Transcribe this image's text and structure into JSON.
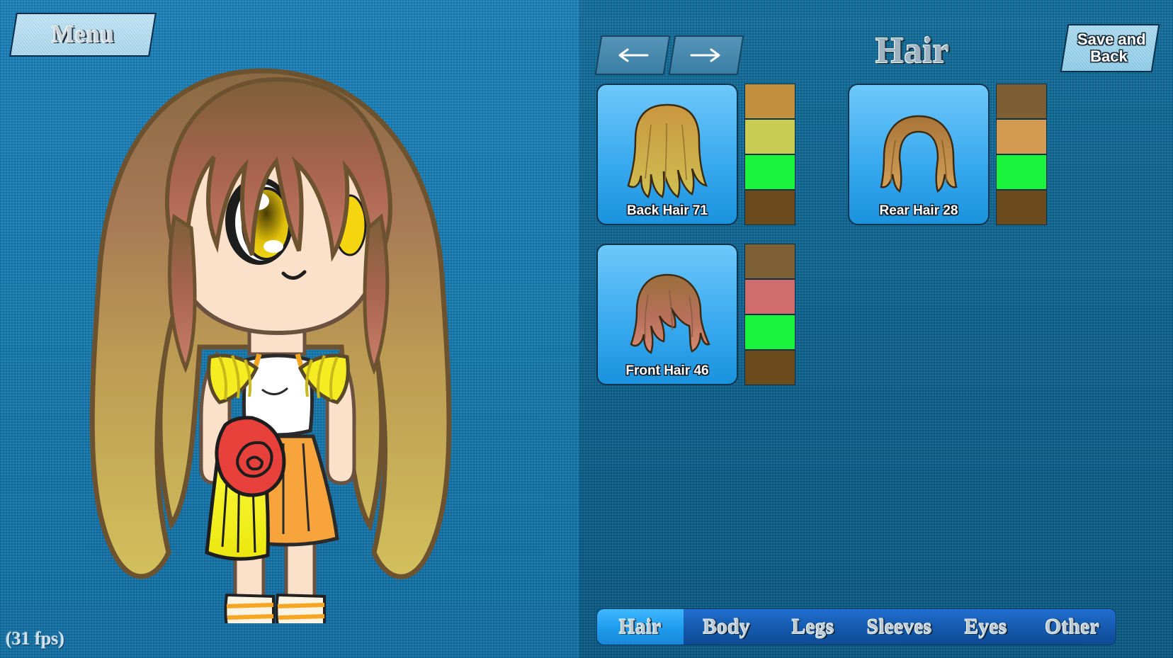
{
  "app": {
    "menu_label": "Menu",
    "fps_label": "(31 fps)"
  },
  "editor": {
    "category_title": "Hair",
    "prev_label": "←",
    "next_label": "→",
    "save_back_line1": "Save and",
    "save_back_line2": "Back"
  },
  "items": [
    {
      "label": "Back Hair 71",
      "thumb": "back-hair-thumb",
      "swatches": [
        "#c0903f",
        "#c9cc53",
        "#1bf43c",
        "#6b4a1e"
      ]
    },
    {
      "label": "Rear Hair 28",
      "thumb": "rear-hair-thumb",
      "swatches": [
        "#7d5f33",
        "#d39b52",
        "#1bf43c",
        "#6b4a1e"
      ]
    },
    {
      "label": "Front Hair 46",
      "thumb": "front-hair-thumb",
      "swatches": [
        "#7d6134",
        "#cf6d6d",
        "#1bf43c",
        "#6b4a1e"
      ]
    }
  ],
  "tabs": [
    {
      "label": "Hair",
      "active": true
    },
    {
      "label": "Body",
      "active": false
    },
    {
      "label": "Legs",
      "active": false
    },
    {
      "label": "Sleeves",
      "active": false
    },
    {
      "label": "Eyes",
      "active": false
    },
    {
      "label": "Other",
      "active": false
    }
  ],
  "colors": {
    "panel_left": "#1579b0",
    "panel_right": "#0f6693",
    "card_blue": "#36a8ee",
    "tab_active": "#1e9ced",
    "tab_inactive": "#1559ad"
  },
  "character": {
    "hair_top": "#8a6a43",
    "hair_mid": "#b97b5a",
    "hair_bottom": "#c9b355",
    "skin": "#fbe0ca",
    "top_white": "#ffffff",
    "skirt_orange": "#f7a43c",
    "skirt_yellow": "#f5ec22",
    "rose_red": "#e8413c",
    "eye_yellow": "#f5d510",
    "shoe_white": "#fdf3e2",
    "shoe_gold": "#f5a623"
  }
}
